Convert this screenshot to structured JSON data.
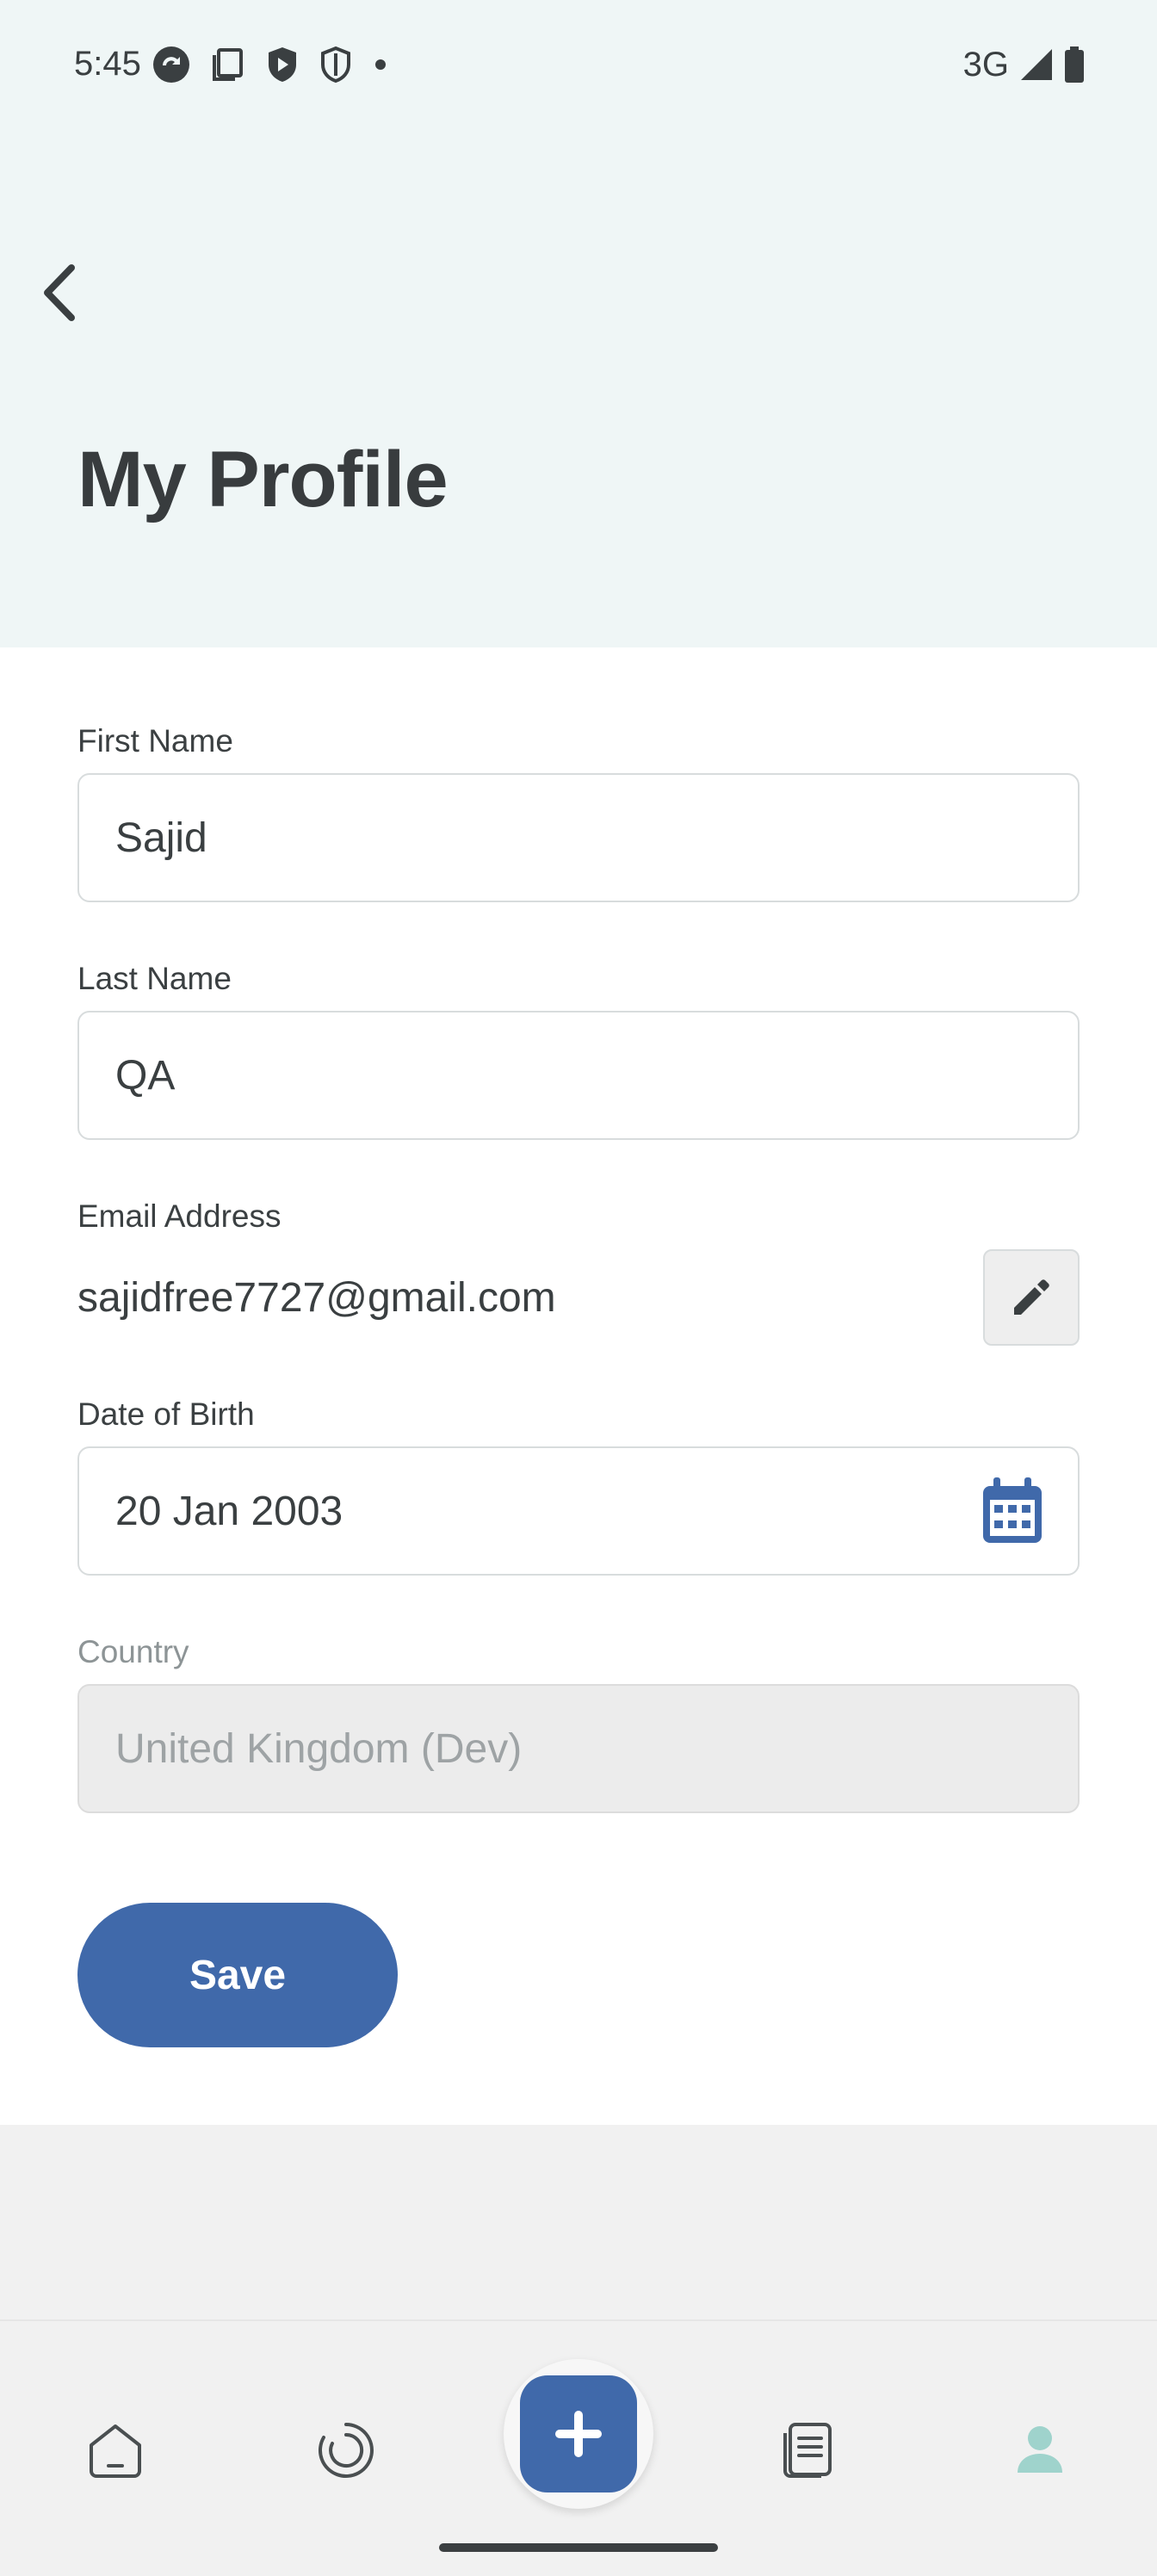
{
  "status_bar": {
    "time": "5:45",
    "network": "3G",
    "left_icons": [
      "sync-icon",
      "clipboard-icon",
      "shield-play-icon",
      "shield-icon",
      "dot-icon"
    ],
    "right_icons": [
      "signal-icon",
      "battery-icon"
    ]
  },
  "header": {
    "title": "My Profile",
    "back_icon": "chevron-left-icon"
  },
  "form": {
    "first_name": {
      "label": "First Name",
      "value": "Sajid"
    },
    "last_name": {
      "label": "Last Name",
      "value": "QA"
    },
    "email": {
      "label": "Email Address",
      "value": "sajidfree7727@gmail.com",
      "edit_icon": "pencil-icon"
    },
    "dob": {
      "label": "Date of Birth",
      "value": "20 Jan 2003",
      "icon": "calendar-icon"
    },
    "country": {
      "label": "Country",
      "value": "United Kingdom (Dev)",
      "disabled": true
    }
  },
  "save_label": "Save",
  "bottom_nav": {
    "items": [
      "home-icon",
      "progress-icon",
      "add-icon",
      "documents-icon",
      "profile-icon"
    ],
    "active": "profile-icon"
  },
  "colors": {
    "accent": "#4069aa",
    "header_bg": "#eff6f6",
    "active_nav": "#9fd3cc"
  }
}
